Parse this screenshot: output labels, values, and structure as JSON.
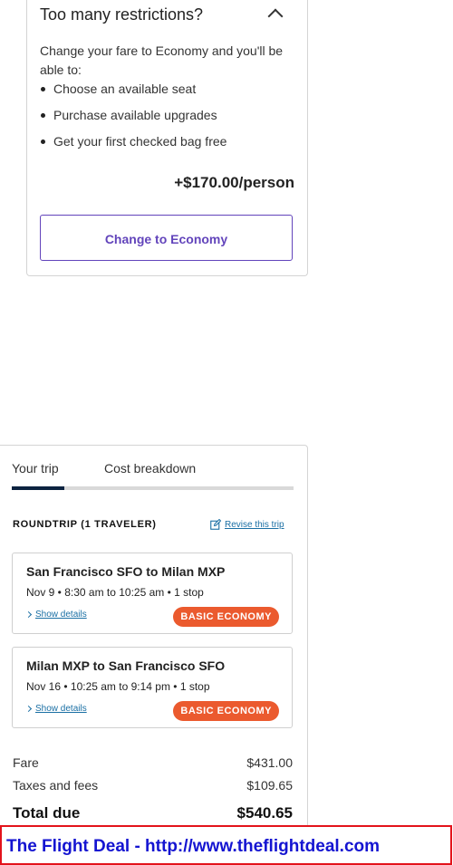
{
  "restrictions_card": {
    "title": "Too many restrictions?",
    "description": "Change your fare to Economy and you'll be able to:",
    "perks": [
      "Choose an available seat",
      "Purchase available upgrades",
      "Get your first checked bag free"
    ],
    "upgrade_price": "+$170.00/person",
    "change_button_label": "Change to Economy",
    "accent_color": "#6244bb"
  },
  "trip_card": {
    "tabs": [
      {
        "label": "Your trip",
        "active": true
      },
      {
        "label": "Cost breakdown",
        "active": false
      }
    ],
    "header": "ROUNDTRIP (1 TRAVELER)",
    "revise_link": "Revise this trip",
    "segments": [
      {
        "route": "San Francisco SFO to Milan MXP",
        "times": "Nov 9 • 8:30 am to 10:25 am • 1 stop",
        "details_link": "Show details",
        "fare_badge": "BASIC ECONOMY"
      },
      {
        "route": "Milan MXP to San Francisco SFO",
        "times": "Nov 16 • 10:25 am to 9:14 pm • 1 stop",
        "details_link": "Show details",
        "fare_badge": "BASIC ECONOMY"
      }
    ],
    "costs": {
      "fare_label": "Fare",
      "fare_value": "$431.00",
      "taxes_label": "Taxes and fees",
      "taxes_value": "$109.65",
      "total_label": "Total due",
      "total_value": "$540.65"
    },
    "badge_color": "#eb5a2e",
    "link_color": "#1a6fa4"
  },
  "footer": {
    "text": "The Flight Deal - http://www.theflightdeal.com",
    "border_color": "#e3131b",
    "text_color": "#1414d1"
  }
}
